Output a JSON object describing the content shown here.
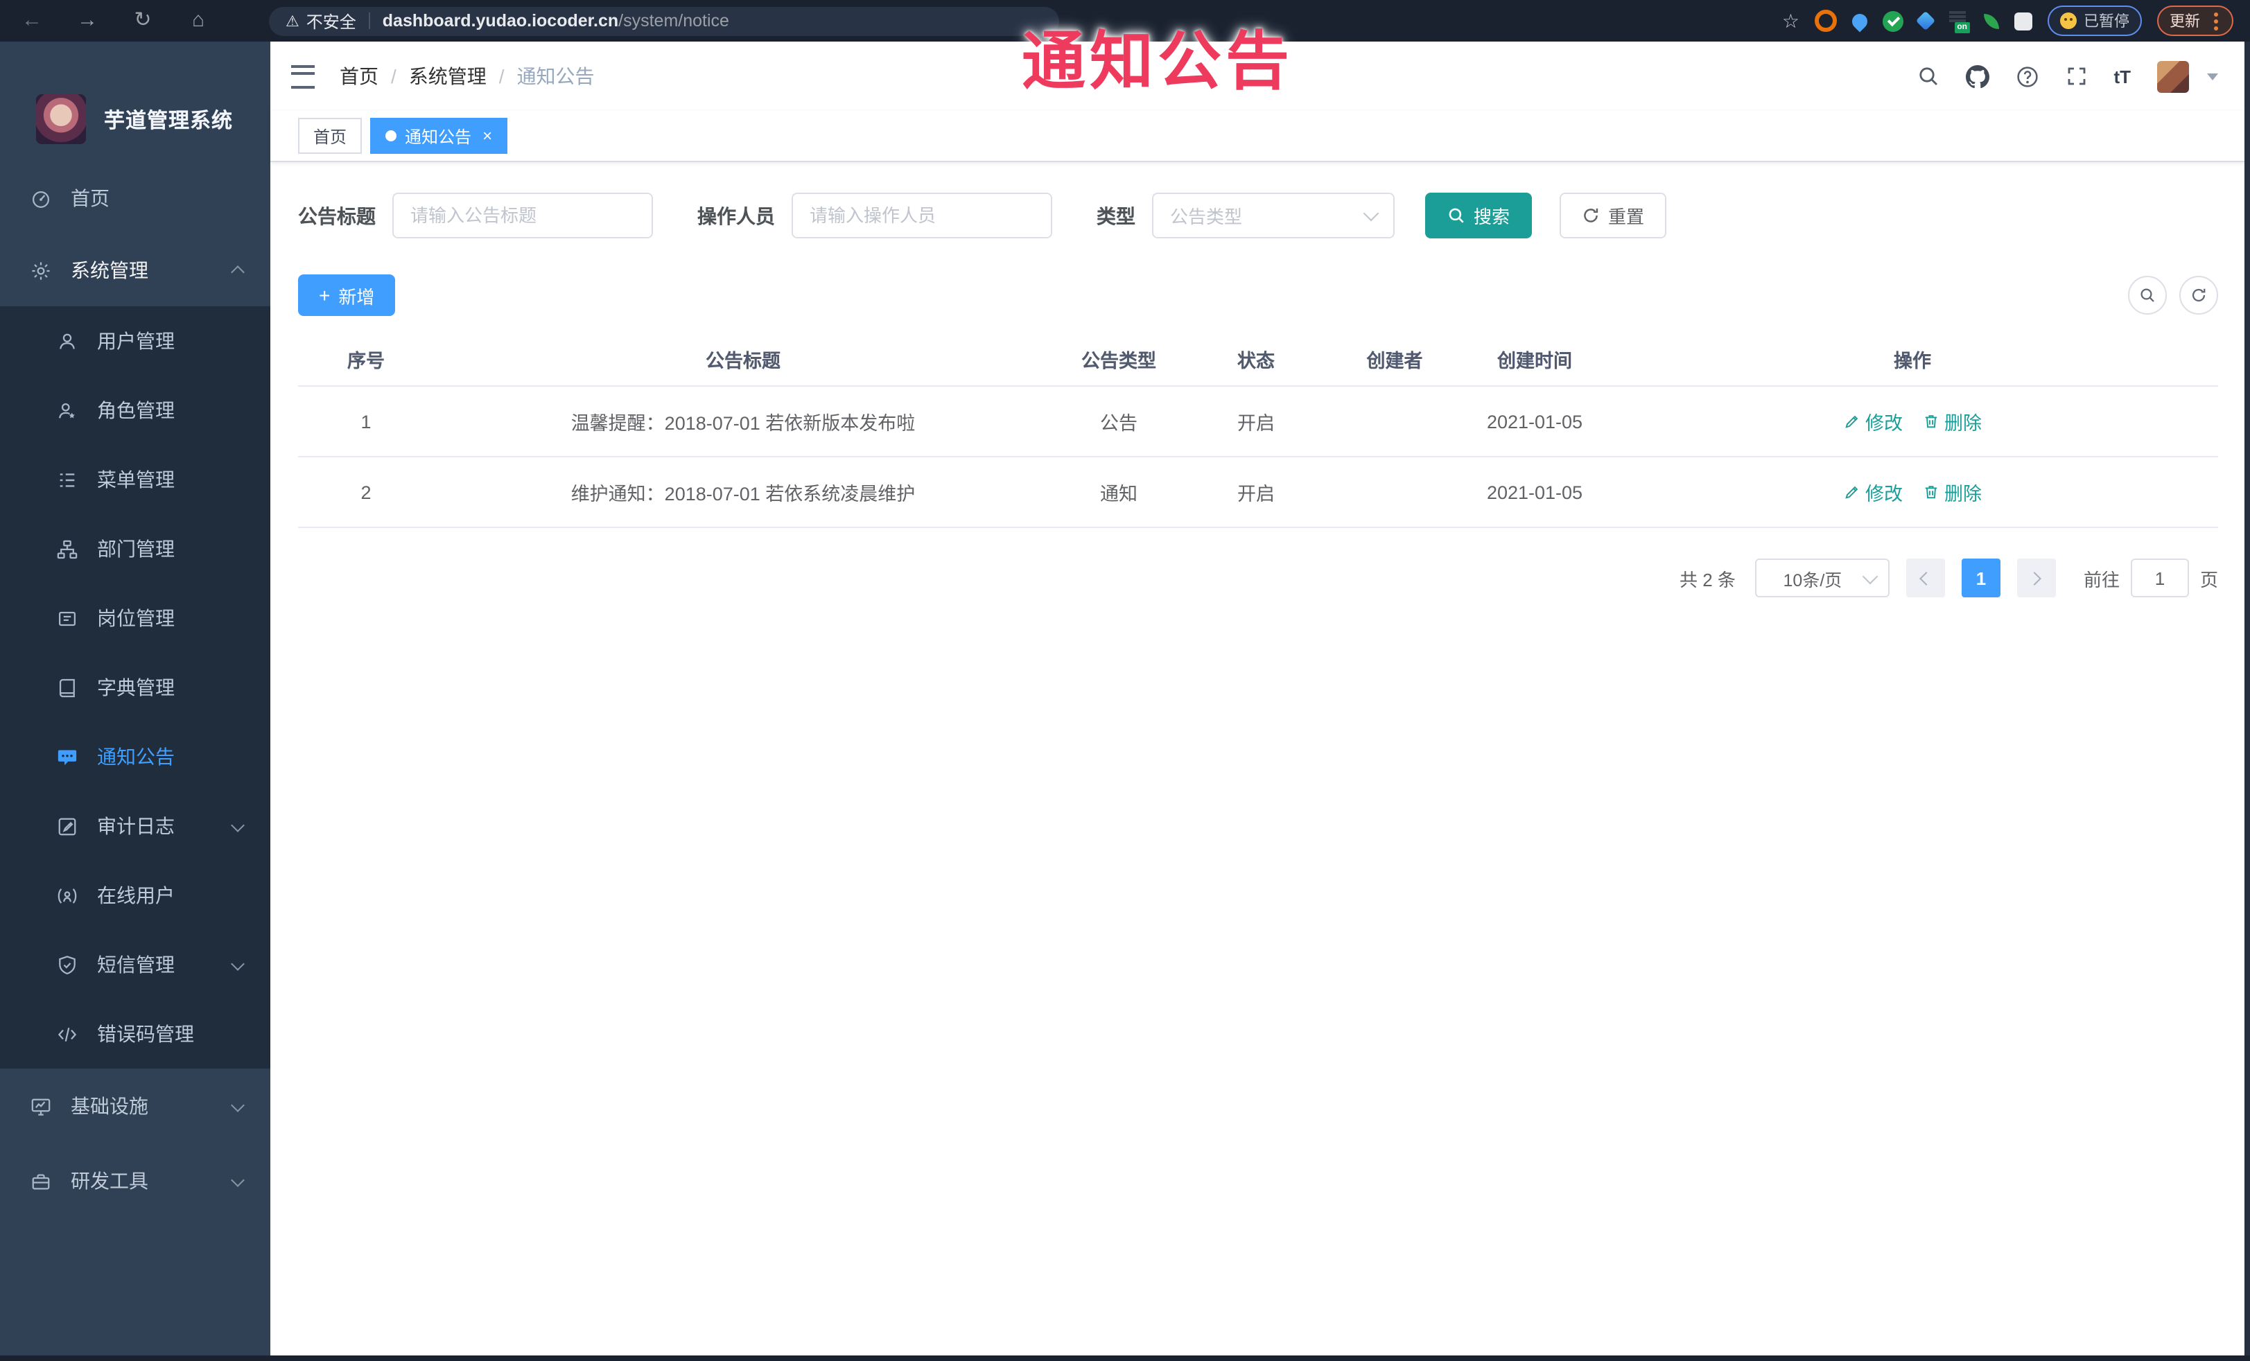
{
  "colors": {
    "accent_blue": "#409eff",
    "teal": "#1b9e97",
    "overlay_red": "#ee3b5d",
    "sidebar_bg": "#304156",
    "submenu_bg": "#1f2d3d",
    "chrome_bg": "#1a2230"
  },
  "browser": {
    "security_label": "不安全",
    "url_host": "dashboard.yudao.iocoder.cn",
    "url_path": "/system/notice",
    "paused_label": "已暂停",
    "update_label": "更新"
  },
  "icons": {
    "back": "←",
    "forward": "→",
    "reload": "↻",
    "home": "⌂",
    "warning": "⚠",
    "star": "☆",
    "font_size": "tT",
    "close": "×",
    "plus": "+",
    "on_badge": "on"
  },
  "overlay": {
    "text": "通知公告"
  },
  "sidebar": {
    "title": "芋道管理系统",
    "items": [
      {
        "label": "首页"
      },
      {
        "label": "系统管理"
      },
      {
        "label": "用户管理"
      },
      {
        "label": "角色管理"
      },
      {
        "label": "菜单管理"
      },
      {
        "label": "部门管理"
      },
      {
        "label": "岗位管理"
      },
      {
        "label": "字典管理"
      },
      {
        "label": "通知公告"
      },
      {
        "label": "审计日志"
      },
      {
        "label": "在线用户"
      },
      {
        "label": "短信管理"
      },
      {
        "label": "错误码管理"
      },
      {
        "label": "基础设施"
      },
      {
        "label": "研发工具"
      }
    ]
  },
  "breadcrumb": {
    "items": [
      "首页",
      "系统管理",
      "通知公告"
    ],
    "separator": "/"
  },
  "tabs": [
    {
      "label": "首页"
    },
    {
      "label": "通知公告"
    }
  ],
  "search": {
    "title_label": "公告标题",
    "title_placeholder": "请输入公告标题",
    "operator_label": "操作人员",
    "operator_placeholder": "请输入操作人员",
    "type_label": "类型",
    "type_placeholder": "公告类型",
    "search_label": "搜索",
    "reset_label": "重置"
  },
  "toolbar": {
    "add_label": "新增"
  },
  "table": {
    "columns": [
      "序号",
      "公告标题",
      "公告类型",
      "状态",
      "创建者",
      "创建时间",
      "操作"
    ],
    "rows": [
      {
        "no": "1",
        "title": "温馨提醒：2018-07-01 若依新版本发布啦",
        "type": "公告",
        "status": "开启",
        "creator": "",
        "created": "2021-01-05"
      },
      {
        "no": "2",
        "title": "维护通知：2018-07-01 若依系统凌晨维护",
        "type": "通知",
        "status": "开启",
        "creator": "",
        "created": "2021-01-05"
      }
    ],
    "edit_label": "修改",
    "delete_label": "删除"
  },
  "pagination": {
    "total": "共 2 条",
    "page_size": "10条/页",
    "current_page": "1",
    "goto_label": "前往",
    "goto_value": "1",
    "unit_label": "页"
  }
}
